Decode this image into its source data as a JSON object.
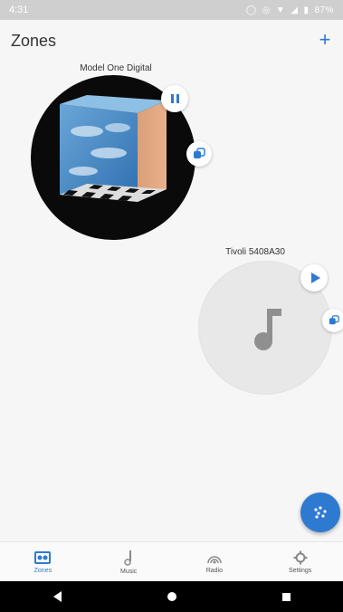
{
  "status_bar": {
    "time": "4:31",
    "battery": "87%"
  },
  "header": {
    "title": "Zones",
    "add_label": "+"
  },
  "zones": [
    {
      "name": "Model One Digital",
      "state": "playing",
      "control": "pause"
    },
    {
      "name": "Tivoli 5408A30",
      "state": "paused",
      "control": "play"
    }
  ],
  "bottom_nav": {
    "items": [
      {
        "label": "Zones",
        "icon": "speaker-icon",
        "active": true
      },
      {
        "label": "Music",
        "icon": "music-note-icon",
        "active": false
      },
      {
        "label": "Radio",
        "icon": "radio-icon",
        "active": false
      },
      {
        "label": "Settings",
        "icon": "gear-icon",
        "active": false
      }
    ]
  },
  "colors": {
    "accent": "#2e7ad1",
    "background": "#f6f6f6"
  }
}
